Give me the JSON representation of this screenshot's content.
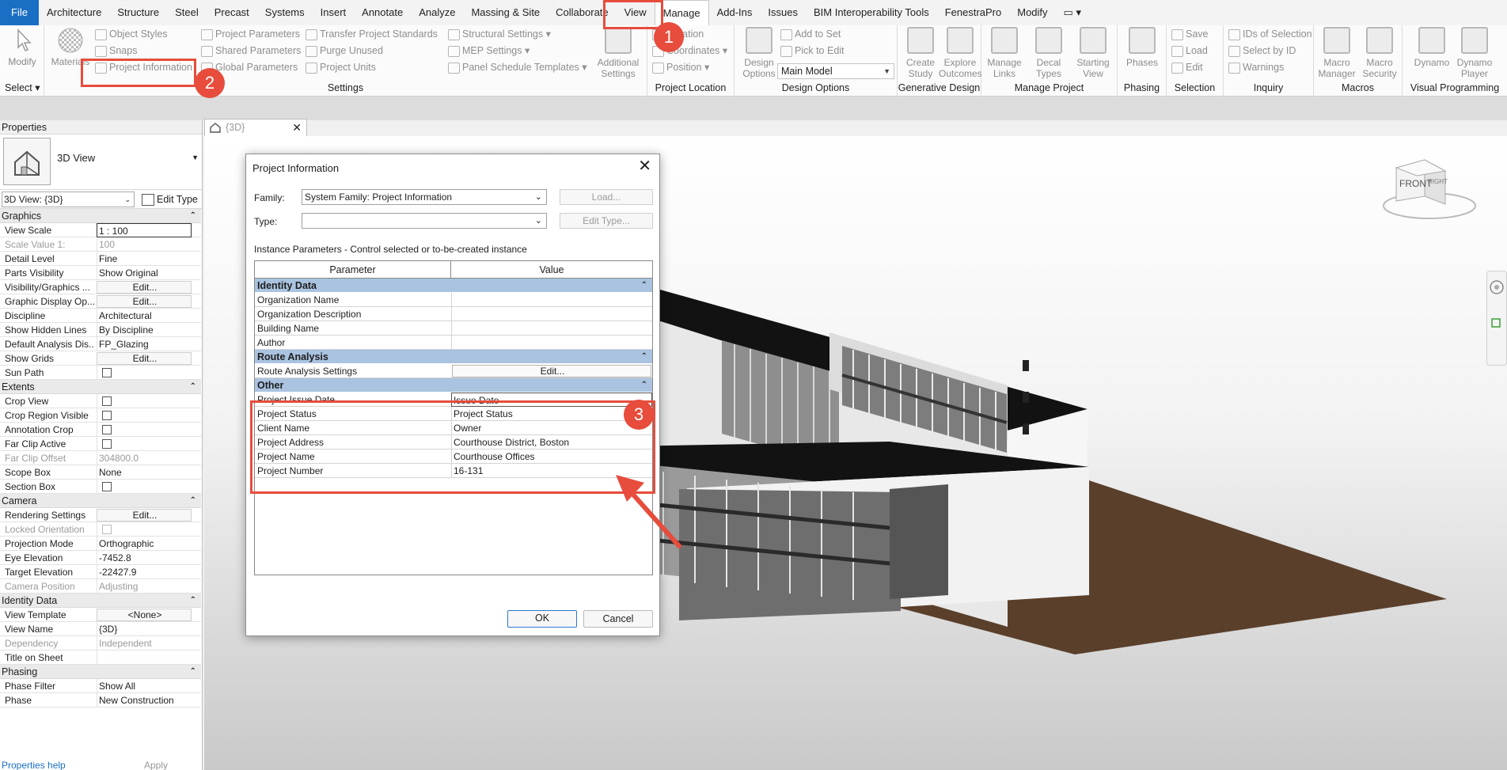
{
  "menu": {
    "items": [
      "File",
      "Architecture",
      "Structure",
      "Steel",
      "Precast",
      "Systems",
      "Insert",
      "Annotate",
      "Analyze",
      "Massing & Site",
      "Collaborate",
      "View",
      "Manage",
      "Add-Ins",
      "Issues",
      "BIM Interoperability Tools",
      "FenestraPro",
      "Modify"
    ],
    "active": "Manage"
  },
  "ribbon": {
    "select": {
      "modify": "Modify",
      "title": "Select"
    },
    "settings": {
      "materials": "Materials",
      "object_styles": "Object Styles",
      "snaps": "Snaps",
      "project_information": "Project Information",
      "project_parameters": "Project Parameters",
      "shared_parameters": "Shared Parameters",
      "global_parameters": "Global Parameters",
      "transfer_project_standards": "Transfer Project Standards",
      "purge_unused": "Purge Unused",
      "project_units": "Project Units",
      "structural_settings": "Structural Settings",
      "mep_settings": "MEP Settings",
      "panel_schedule_templates": "Panel Schedule Templates",
      "additional_settings_1": "Additional",
      "additional_settings_2": "Settings",
      "title": "Settings"
    },
    "project_location": {
      "location": "Location",
      "coordinates": "Coordinates",
      "position": "Position",
      "title": "Project Location"
    },
    "design_options": {
      "design_options_1": "Design",
      "design_options_2": "Options",
      "add_to_set": "Add to Set",
      "pick_to_edit": "Pick to Edit",
      "main_model": "Main Model",
      "title": "Design Options"
    },
    "generative_design": {
      "create_study_1": "Create",
      "create_study_2": "Study",
      "explore_outcomes_1": "Explore",
      "explore_outcomes_2": "Outcomes",
      "title": "Generative Design"
    },
    "manage_project": {
      "manage_links_1": "Manage",
      "manage_links_2": "Links",
      "decal_types_1": "Decal",
      "decal_types_2": "Types",
      "starting_view_1": "Starting",
      "starting_view_2": "View",
      "title": "Manage Project"
    },
    "phasing": {
      "phases": "Phases",
      "title": "Phasing"
    },
    "selection": {
      "save": "Save",
      "load": "Load",
      "edit": "Edit",
      "title": "Selection"
    },
    "inquiry": {
      "ids_of_selection": "IDs of Selection",
      "select_by_id": "Select by ID",
      "warnings": "Warnings",
      "title": "Inquiry"
    },
    "macros": {
      "macro_manager_1": "Macro",
      "macro_manager_2": "Manager",
      "macro_security_1": "Macro",
      "macro_security_2": "Security",
      "title": "Macros"
    },
    "visual_programming": {
      "dynamo": "Dynamo",
      "dynamo_player_1": "Dynamo",
      "dynamo_player_2": "Player",
      "title": "Visual Programming"
    }
  },
  "annotations": {
    "n1": "1",
    "n2": "2",
    "n3": "3"
  },
  "view_tab": {
    "label": "{3D}"
  },
  "properties": {
    "title": "Properties",
    "type_name": "3D View",
    "instance_selector": "3D View: {3D}",
    "edit_type": "Edit Type",
    "help": "Properties help",
    "apply": "Apply",
    "groups": [
      {
        "name": "Graphics",
        "rows": [
          {
            "name": "View Scale",
            "value": "1 : 100",
            "kind": "boxed"
          },
          {
            "name": "Scale Value    1:",
            "value": "100",
            "kind": "grey"
          },
          {
            "name": "Detail Level",
            "value": "Fine"
          },
          {
            "name": "Parts Visibility",
            "value": "Show Original"
          },
          {
            "name": "Visibility/Graphics ...",
            "value": "Edit...",
            "kind": "btn"
          },
          {
            "name": "Graphic Display Op...",
            "value": "Edit...",
            "kind": "btn"
          },
          {
            "name": "Discipline",
            "value": "Architectural"
          },
          {
            "name": "Show Hidden Lines",
            "value": "By Discipline"
          },
          {
            "name": "Default Analysis Dis...",
            "value": "FP_Glazing"
          },
          {
            "name": "Show Grids",
            "value": "Edit...",
            "kind": "btn"
          },
          {
            "name": "Sun Path",
            "value": "",
            "kind": "check"
          }
        ]
      },
      {
        "name": "Extents",
        "rows": [
          {
            "name": "Crop View",
            "value": "",
            "kind": "check"
          },
          {
            "name": "Crop Region Visible",
            "value": "",
            "kind": "check"
          },
          {
            "name": "Annotation Crop",
            "value": "",
            "kind": "check"
          },
          {
            "name": "Far Clip Active",
            "value": "",
            "kind": "check"
          },
          {
            "name": "Far Clip Offset",
            "value": "304800.0",
            "kind": "grey"
          },
          {
            "name": "Scope Box",
            "value": "None"
          },
          {
            "name": "Section Box",
            "value": "",
            "kind": "check"
          }
        ]
      },
      {
        "name": "Camera",
        "rows": [
          {
            "name": "Rendering Settings",
            "value": "Edit...",
            "kind": "btn"
          },
          {
            "name": "Locked Orientation",
            "value": "",
            "kind": "greycheck"
          },
          {
            "name": "Projection Mode",
            "value": "Orthographic"
          },
          {
            "name": "Eye Elevation",
            "value": "-7452.8"
          },
          {
            "name": "Target Elevation",
            "value": "-22427.9"
          },
          {
            "name": "Camera Position",
            "value": "Adjusting",
            "kind": "grey"
          }
        ]
      },
      {
        "name": "Identity Data",
        "rows": [
          {
            "name": "View Template",
            "value": "<None>",
            "kind": "btn"
          },
          {
            "name": "View Name",
            "value": "{3D}"
          },
          {
            "name": "Dependency",
            "value": "Independent",
            "kind": "grey"
          },
          {
            "name": "Title on Sheet",
            "value": ""
          }
        ]
      },
      {
        "name": "Phasing",
        "rows": [
          {
            "name": "Phase Filter",
            "value": "Show All"
          },
          {
            "name": "Phase",
            "value": "New Construction"
          }
        ]
      }
    ]
  },
  "dialog": {
    "title": "Project Information",
    "family_label": "Family:",
    "family_value": "System Family: Project Information",
    "type_label": "Type:",
    "type_value": "",
    "load_button": "Load...",
    "edit_type_button": "Edit Type...",
    "caption": "Instance Parameters - Control selected or to-be-created instance",
    "col_parameter": "Parameter",
    "col_value": "Value",
    "groups": [
      {
        "name": "Identity Data",
        "rows": [
          {
            "name": "Organization Name",
            "value": ""
          },
          {
            "name": "Organization Description",
            "value": ""
          },
          {
            "name": "Building Name",
            "value": ""
          },
          {
            "name": "Author",
            "value": ""
          }
        ]
      },
      {
        "name": "Route Analysis",
        "rows": [
          {
            "name": "Route Analysis Settings",
            "value": "Edit...",
            "kind": "btn"
          }
        ]
      },
      {
        "name": "Other",
        "rows": [
          {
            "name": "Project Issue Date",
            "value": "Issue Date",
            "kind": "edit"
          },
          {
            "name": "Project Status",
            "value": "Project  Status"
          },
          {
            "name": "Client Name",
            "value": "Owner"
          },
          {
            "name": "Project Address",
            "value": "Courthouse District, Boston"
          },
          {
            "name": "Project Name",
            "value": "Courthouse Offices"
          },
          {
            "name": "Project Number",
            "value": "16-131"
          }
        ]
      }
    ],
    "ok": "OK",
    "cancel": "Cancel"
  },
  "viewcube": {
    "front": "FRONT",
    "right": "RIGHT"
  },
  "colors": {
    "accent": "#1a6fc4",
    "annotation": "#e74c3c",
    "group_header": "#a9c3e0",
    "ground": "#5a3f2b"
  }
}
